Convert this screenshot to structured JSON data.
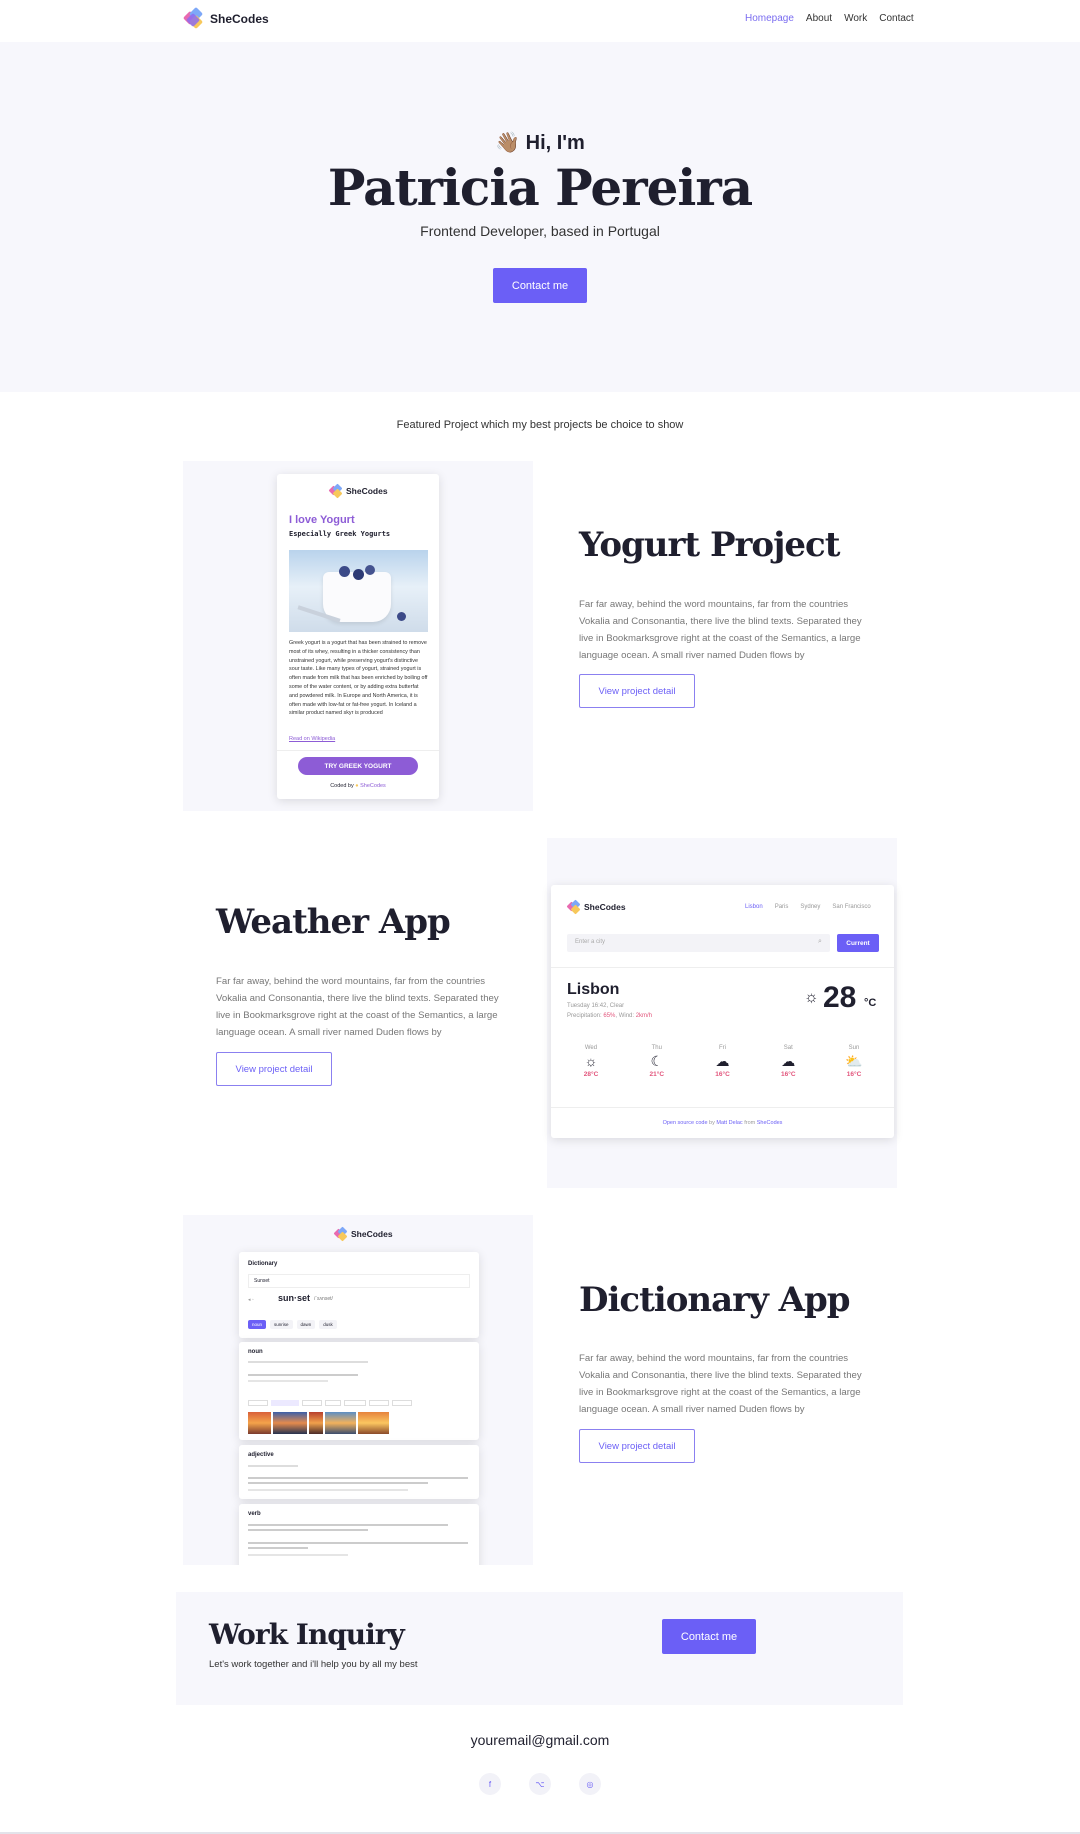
{
  "nav": {
    "brand": "SheCodes",
    "links": [
      "Homepage",
      "About",
      "Work",
      "Contact"
    ]
  },
  "hero": {
    "wave_icon": "👋🏽",
    "greeting": "Hi, I'm",
    "name": "Patricia Pereira",
    "role": "Frontend Developer, based in Portugal",
    "cta": "Contact me"
  },
  "featured_heading": "Featured Project which my best projects be choice to show",
  "projects": [
    {
      "title": "Yogurt Project",
      "description": "Far far away, behind the word mountains, far from the countries Vokalia and Consonantia, there live the blind texts. Separated they live in Bookmarksgrove right at the coast of the Semantics, a large language ocean. A small river named Duden flows by",
      "button": "View project detail"
    },
    {
      "title": "Weather App",
      "description": "Far far away, behind the word mountains, far from the countries Vokalia and Consonantia, there live the blind texts. Separated they live in Bookmarksgrove right at the coast of the Semantics, a large language ocean. A small river named Duden flows by",
      "button": "View project detail"
    },
    {
      "title": "Dictionary App",
      "description": "Far far away, behind the word mountains, far from the countries Vokalia and Consonantia, there live the blind texts. Separated they live in Bookmarksgrove right at the coast of the Semantics, a large language ocean. A small river named Duden flows by",
      "button": "View project detail"
    }
  ],
  "yogurt_preview": {
    "brand": "SheCodes",
    "title": "I love Yogurt",
    "subtitle": "Especially Greek Yogurts",
    "body": "Greek yogurt is a yogurt that has been strained to remove most of its whey, resulting in a thicker consistency than unstrained yogurt, while preserving yogurt's distinctive sour taste. Like many types of yogurt, strained yogurt is often made from milk that has been enriched by boiling off some of the water content, or by adding extra butterfat and powdered milk. In Europe and North America, it is often made with low-fat or fat-free yogurt. In Iceland a similar product named skyr is produced",
    "link": "Read on Wikipedia",
    "button": "TRY GREEK YOGURT",
    "footer_prefix": "Coded by",
    "footer_brand": "SheCodes"
  },
  "weather_preview": {
    "brand": "SheCodes",
    "cities": [
      "Lisbon",
      "Paris",
      "Sydney",
      "San Francisco"
    ],
    "search_placeholder": "Enter a city",
    "current_button": "Current",
    "city": "Lisbon",
    "datetime": "Tuesday 16:42, Clear",
    "precip_label": "Precipitation:",
    "precip_value": "65%",
    "wind_label": ", Wind:",
    "wind_value": "2km/h",
    "temp": "28",
    "unit": "°C",
    "forecast": [
      {
        "day": "Wed",
        "temp": "28°C",
        "icon": "sun-icon"
      },
      {
        "day": "Thu",
        "temp": "21°C",
        "icon": "moon-icon"
      },
      {
        "day": "Fri",
        "temp": "16°C",
        "icon": "cloud-icon"
      },
      {
        "day": "Sat",
        "temp": "16°C",
        "icon": "cloud-moon-icon"
      },
      {
        "day": "Sun",
        "temp": "16°C",
        "icon": "sun-cloud-icon"
      }
    ],
    "footer_link": "Open source code",
    "footer_by": "by",
    "footer_author": "Matt Delac",
    "footer_from": "from",
    "footer_brand": "SheCodes"
  },
  "dictionary_preview": {
    "brand": "SheCodes",
    "heading": "Dictionary",
    "search_value": "Sunset",
    "word": "sun·set",
    "phonetic": "/ˈsʌnset/",
    "tags": [
      "noun",
      "sunrise",
      "dawn",
      "dusk"
    ],
    "noun_label": "noun",
    "adjective_label": "adjective",
    "verb_label": "verb"
  },
  "inquiry": {
    "title": "Work Inquiry",
    "subtitle": "Let's work together and i'll help you by all my best",
    "button": "Contact me"
  },
  "email": "youremail@gmail.com",
  "social": [
    "f",
    "⌥",
    "◎"
  ],
  "colors": {
    "accent": "#6b5ff6",
    "section_bg": "#f7f7fc",
    "pink": "#e2557c"
  }
}
